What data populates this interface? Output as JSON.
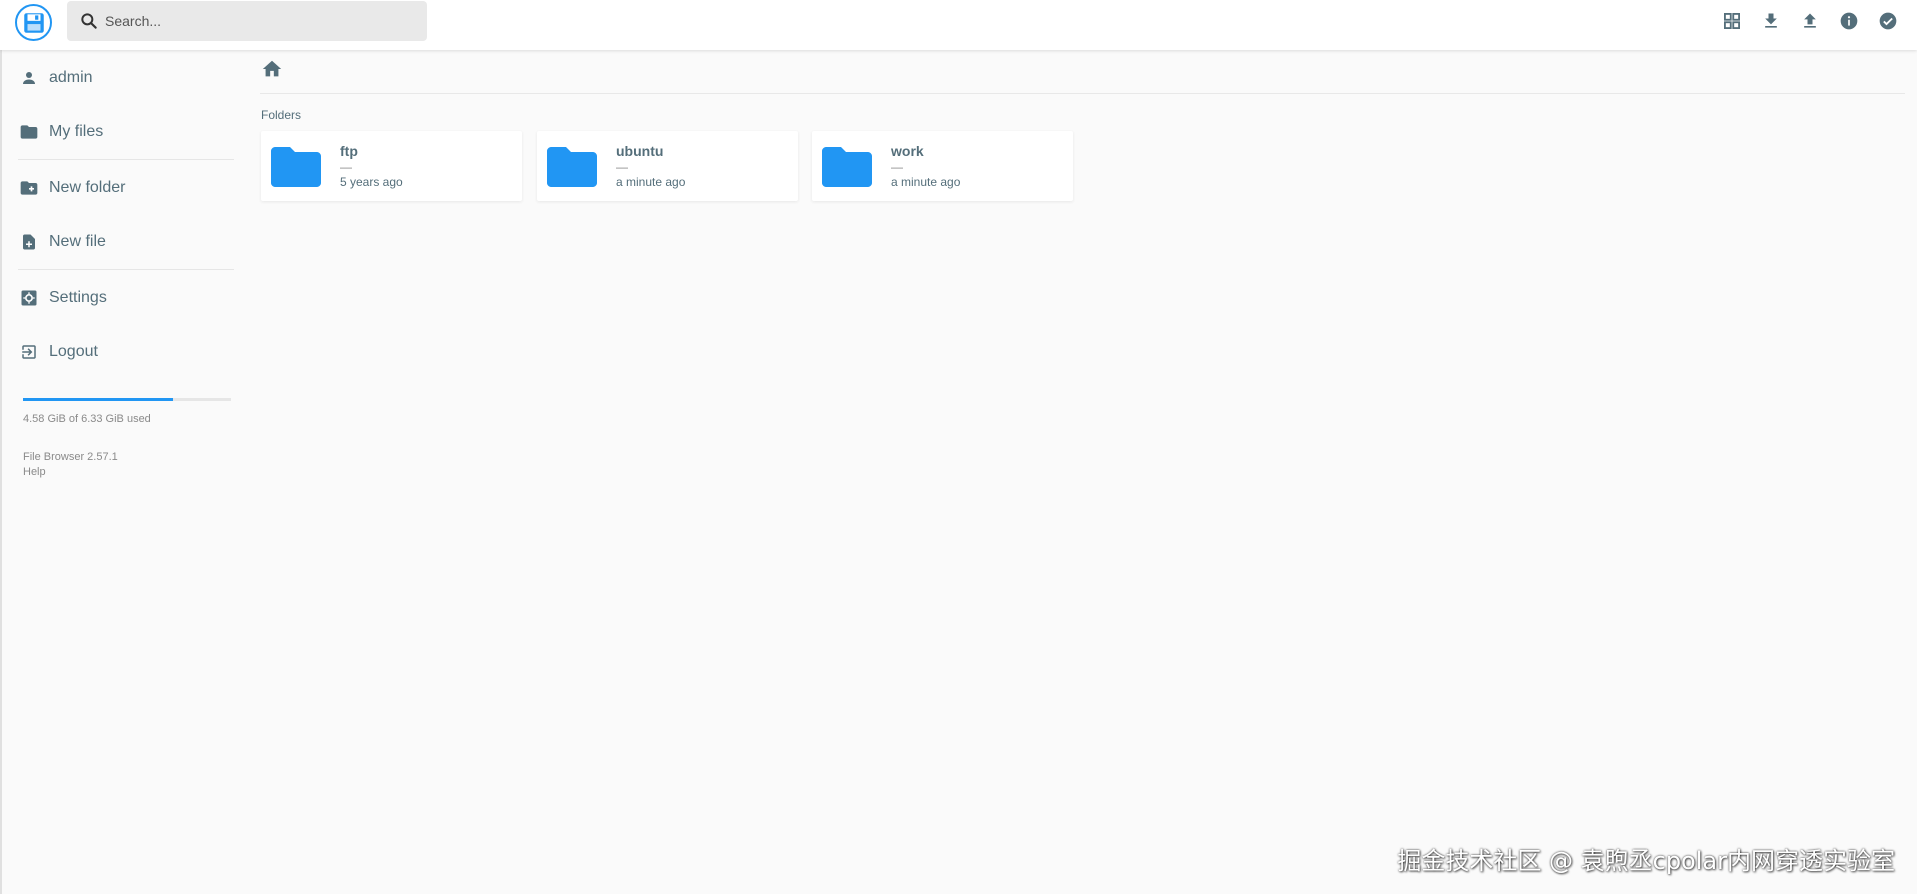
{
  "header": {
    "search_placeholder": "Search...",
    "actions": [
      "grid-view",
      "download",
      "upload",
      "info",
      "select"
    ]
  },
  "sidebar": {
    "items": [
      {
        "label": "admin",
        "icon": "person-icon"
      },
      {
        "label": "My files",
        "icon": "folder-icon"
      },
      {
        "label": "New folder",
        "icon": "create-new-folder-icon"
      },
      {
        "label": "New file",
        "icon": "note-add-icon"
      },
      {
        "label": "Settings",
        "icon": "settings-icon"
      },
      {
        "label": "Logout",
        "icon": "exit-icon"
      }
    ],
    "usage": {
      "text": "4.58 GiB of 6.33 GiB used",
      "fraction": 0.72
    },
    "version": "File Browser 2.57.1",
    "help": "Help"
  },
  "main": {
    "section_title": "Folders",
    "folders": [
      {
        "name": "ftp",
        "size": "—",
        "modified": "5 years ago"
      },
      {
        "name": "ubuntu",
        "size": "—",
        "modified": "a minute ago"
      },
      {
        "name": "work",
        "size": "—",
        "modified": "a minute ago"
      }
    ]
  },
  "watermark": "掘金技术社区 @ 袁煦丞cpolar内网穿透实验室",
  "colors": {
    "accent": "#2196f3",
    "text": "#546e7a",
    "icon": "#546e7a"
  }
}
